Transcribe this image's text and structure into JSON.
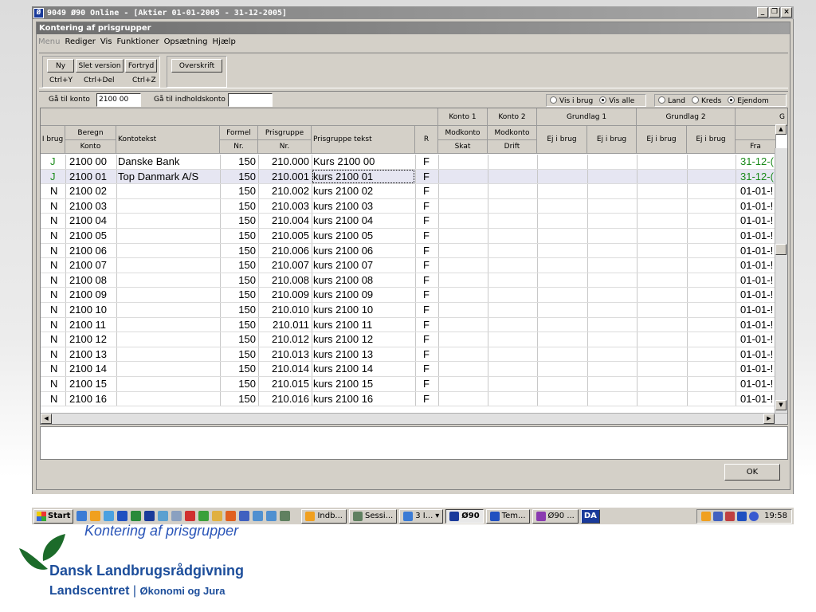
{
  "outer_window": {
    "title": "9049  Ø90 Online - [Aktier  01-01-2005 - 31-12-2005]",
    "controls": [
      "_",
      "❐",
      "×"
    ]
  },
  "dialog": {
    "title": "Kontering af prisgrupper"
  },
  "menu": [
    "Menu",
    "Rediger",
    "Vis",
    "Funktioner",
    "Opsætning",
    "Hjælp"
  ],
  "toolbar": {
    "buttons": [
      "Ny",
      "Slet version",
      "Fortryd",
      "Overskrift"
    ],
    "shortcuts": [
      "Ctrl+Y",
      "Ctrl+Del",
      "Ctrl+Z"
    ]
  },
  "nav": {
    "goto_account_label": "Gå til konto",
    "goto_account_value": "2100 00",
    "goto_content_label": "Gå til indholdskonto",
    "goto_content_value": "",
    "view_options": [
      {
        "label": "Vis i brug",
        "checked": false
      },
      {
        "label": "Vis alle",
        "checked": true
      }
    ],
    "type_options": [
      {
        "label": "Land",
        "checked": false
      },
      {
        "label": "Kreds",
        "checked": false
      },
      {
        "label": "Ejendom",
        "checked": true
      }
    ]
  },
  "grid": {
    "group_headers": [
      "Konto 1",
      "Konto 2",
      "Grundlag 1",
      "Grundlag 2",
      "G"
    ],
    "headers": {
      "ibrug": "I brug",
      "beregn": "Beregn",
      "konto": "Konto",
      "kontotekst": "Kontotekst",
      "formel": "Formel",
      "formel_nr": "Nr.",
      "prisgruppe": "Prisgruppe",
      "prisgruppe_nr": "Nr.",
      "prisgruppe_tekst": "Prisgruppe tekst",
      "r": "R",
      "modkonto1": "Modkonto",
      "skat": "Skat",
      "modkonto2": "Modkonto",
      "drift": "Drift",
      "ej1": "Ej i brug",
      "ej2": "Ej i brug",
      "ej3": "Ej i brug",
      "ej4": "Ej i brug",
      "fra": "Fra"
    },
    "rows": [
      {
        "ibrug": "J",
        "konto": "2100 00",
        "tekst": "Danske Bank",
        "formel": "150",
        "prisgruppe": "210.000",
        "pg_tekst": "Kurs 2100 00",
        "r": "F",
        "fra": "31-12-("
      },
      {
        "ibrug": "J",
        "konto": "2100 01",
        "tekst": "Top Danmark A/S",
        "formel": "150",
        "prisgruppe": "210.001",
        "pg_tekst": "kurs 2100 01",
        "r": "F",
        "fra": "31-12-("
      },
      {
        "ibrug": "N",
        "konto": "2100 02",
        "tekst": "",
        "formel": "150",
        "prisgruppe": "210.002",
        "pg_tekst": "kurs 2100 02",
        "r": "F",
        "fra": "01-01-!"
      },
      {
        "ibrug": "N",
        "konto": "2100 03",
        "tekst": "",
        "formel": "150",
        "prisgruppe": "210.003",
        "pg_tekst": "kurs 2100 03",
        "r": "F",
        "fra": "01-01-!"
      },
      {
        "ibrug": "N",
        "konto": "2100 04",
        "tekst": "",
        "formel": "150",
        "prisgruppe": "210.004",
        "pg_tekst": "kurs 2100 04",
        "r": "F",
        "fra": "01-01-!"
      },
      {
        "ibrug": "N",
        "konto": "2100 05",
        "tekst": "",
        "formel": "150",
        "prisgruppe": "210.005",
        "pg_tekst": "kurs 2100 05",
        "r": "F",
        "fra": "01-01-!"
      },
      {
        "ibrug": "N",
        "konto": "2100 06",
        "tekst": "",
        "formel": "150",
        "prisgruppe": "210.006",
        "pg_tekst": "kurs 2100 06",
        "r": "F",
        "fra": "01-01-!"
      },
      {
        "ibrug": "N",
        "konto": "2100 07",
        "tekst": "",
        "formel": "150",
        "prisgruppe": "210.007",
        "pg_tekst": "kurs 2100 07",
        "r": "F",
        "fra": "01-01-!"
      },
      {
        "ibrug": "N",
        "konto": "2100 08",
        "tekst": "",
        "formel": "150",
        "prisgruppe": "210.008",
        "pg_tekst": "kurs 2100 08",
        "r": "F",
        "fra": "01-01-!"
      },
      {
        "ibrug": "N",
        "konto": "2100 09",
        "tekst": "",
        "formel": "150",
        "prisgruppe": "210.009",
        "pg_tekst": "kurs 2100 09",
        "r": "F",
        "fra": "01-01-!"
      },
      {
        "ibrug": "N",
        "konto": "2100 10",
        "tekst": "",
        "formel": "150",
        "prisgruppe": "210.010",
        "pg_tekst": "kurs 2100 10",
        "r": "F",
        "fra": "01-01-!"
      },
      {
        "ibrug": "N",
        "konto": "2100 11",
        "tekst": "",
        "formel": "150",
        "prisgruppe": "210.011",
        "pg_tekst": "kurs 2100 11",
        "r": "F",
        "fra": "01-01-!"
      },
      {
        "ibrug": "N",
        "konto": "2100 12",
        "tekst": "",
        "formel": "150",
        "prisgruppe": "210.012",
        "pg_tekst": "kurs 2100 12",
        "r": "F",
        "fra": "01-01-!"
      },
      {
        "ibrug": "N",
        "konto": "2100 13",
        "tekst": "",
        "formel": "150",
        "prisgruppe": "210.013",
        "pg_tekst": "kurs 2100 13",
        "r": "F",
        "fra": "01-01-!"
      },
      {
        "ibrug": "N",
        "konto": "2100 14",
        "tekst": "",
        "formel": "150",
        "prisgruppe": "210.014",
        "pg_tekst": "kurs 2100 14",
        "r": "F",
        "fra": "01-01-!"
      },
      {
        "ibrug": "N",
        "konto": "2100 15",
        "tekst": "",
        "formel": "150",
        "prisgruppe": "210.015",
        "pg_tekst": "kurs 2100 15",
        "r": "F",
        "fra": "01-01-!"
      },
      {
        "ibrug": "N",
        "konto": "2100 16",
        "tekst": "",
        "formel": "150",
        "prisgruppe": "210.016",
        "pg_tekst": "kurs 2100 16",
        "r": "F",
        "fra": "01-01-!"
      }
    ]
  },
  "ok_label": "OK",
  "taskbar": {
    "start": "Start",
    "tasks": [
      "Indb...",
      "Sessi...",
      "3 I...",
      "Ø90",
      "Tem...",
      "Ø90 ..."
    ],
    "active_task": "Ø90",
    "lang": "DA",
    "clock": "19:58"
  },
  "slide": {
    "caption": "Kontering af prisgrupper",
    "brand_line1": "Dansk Landbrugsrådgivning",
    "brand_line2": "Landscentret",
    "brand_line2_sep": "|",
    "brand_line2_sub": "Økonomi og Jura"
  },
  "colors": {
    "in_use_green": "#1a8a1a",
    "brand_blue": "#1d4e9b",
    "logo_green": "#1c6b2a",
    "caption_blue": "#2a55b8"
  }
}
